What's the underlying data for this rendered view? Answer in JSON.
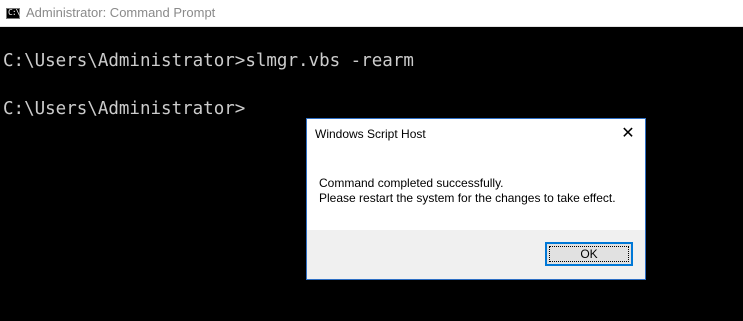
{
  "window": {
    "title": "Administrator: Command Prompt",
    "icon": "cmd-icon",
    "icon_glyph": "C:\\"
  },
  "console": {
    "lines": [
      "C:\\Users\\Administrator>slmgr.vbs -rearm",
      "C:\\Users\\Administrator>"
    ],
    "text_color": "#cccccc",
    "background": "#000000"
  },
  "dialog": {
    "title": "Windows Script Host",
    "close_icon": "close-icon",
    "close_glyph": "✕",
    "message_lines": [
      "Command completed successfully.",
      "Please restart the system for the changes to take effect."
    ],
    "ok_label": "OK",
    "accent": "#0078d7"
  }
}
